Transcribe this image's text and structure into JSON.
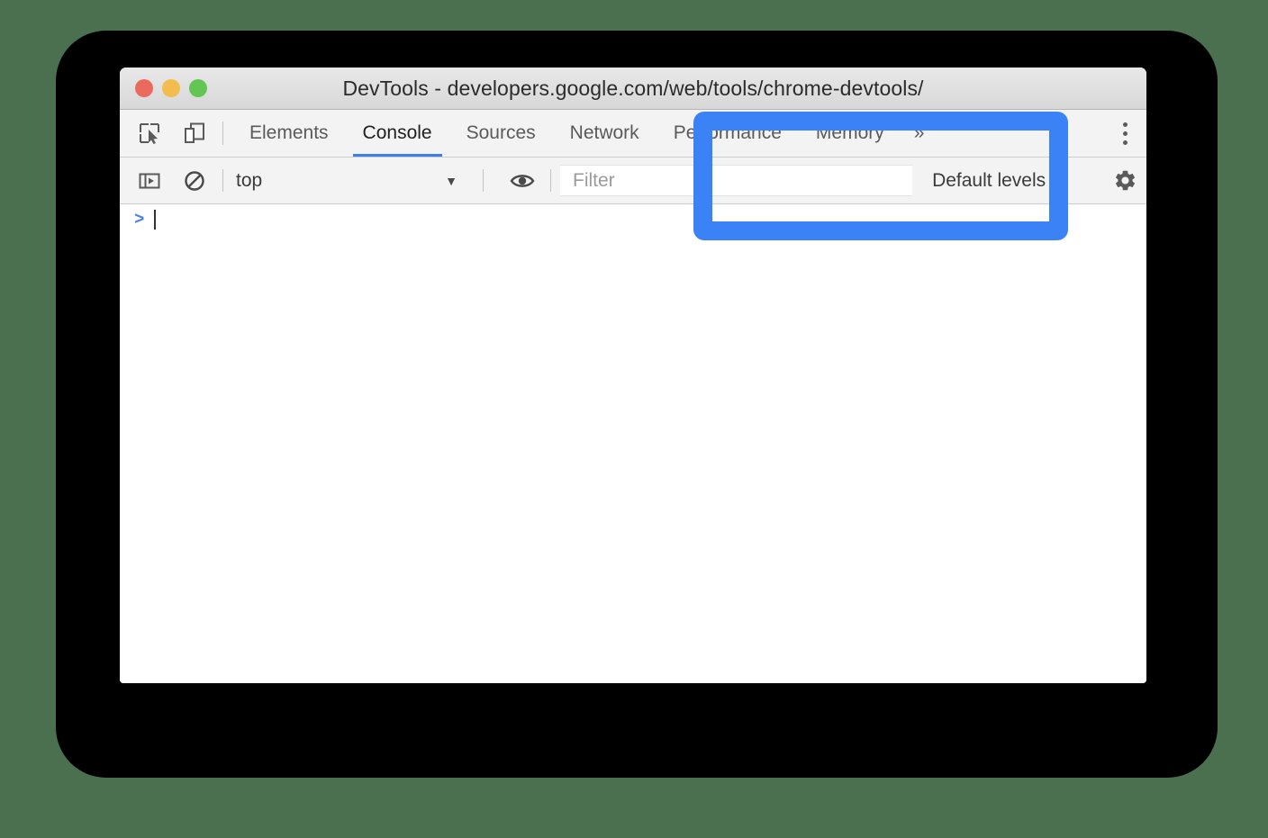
{
  "window": {
    "title": "DevTools - developers.google.com/web/tools/chrome-devtools/",
    "traffic_lights": [
      {
        "name": "close",
        "color": "#ea6a5e"
      },
      {
        "name": "minimize",
        "color": "#f2bd4e"
      },
      {
        "name": "zoom",
        "color": "#62c554"
      }
    ]
  },
  "tabstrip": {
    "inspect_icon": "inspect-element-icon",
    "device_icon": "device-toolbar-icon",
    "tabs": [
      {
        "label": "Elements",
        "active": false
      },
      {
        "label": "Console",
        "active": true
      },
      {
        "label": "Sources",
        "active": false
      },
      {
        "label": "Network",
        "active": false
      },
      {
        "label": "Performance",
        "active": false
      },
      {
        "label": "Memory",
        "active": false
      }
    ],
    "more_tabs_label": "»",
    "menu_icon": "kebab-menu-icon"
  },
  "filterbar": {
    "sidebar_toggle_icon": "console-sidebar-icon",
    "clear_icon": "clear-console-icon",
    "context": {
      "value": "top",
      "caret": "▼"
    },
    "eye_icon": "live-expression-eye-icon",
    "filter": {
      "placeholder": "Filter",
      "value": ""
    },
    "levels": {
      "label": "Default levels",
      "caret": "▼"
    },
    "settings_icon": "settings-gear-icon"
  },
  "console": {
    "prompt_symbol": ">",
    "input_value": ""
  },
  "annotation": {
    "type": "highlight-rectangle",
    "color": "#3b82f6",
    "target": "log-level-filter-controls"
  },
  "colors": {
    "page_background": "#4a7050",
    "backdrop": "#000000",
    "window_background": "#ffffff",
    "toolbar_background": "#f3f3f3",
    "active_tab_underline": "#3b7de9",
    "prompt_arrow": "#4f7fe8",
    "highlight_blue": "#3b82f6"
  }
}
